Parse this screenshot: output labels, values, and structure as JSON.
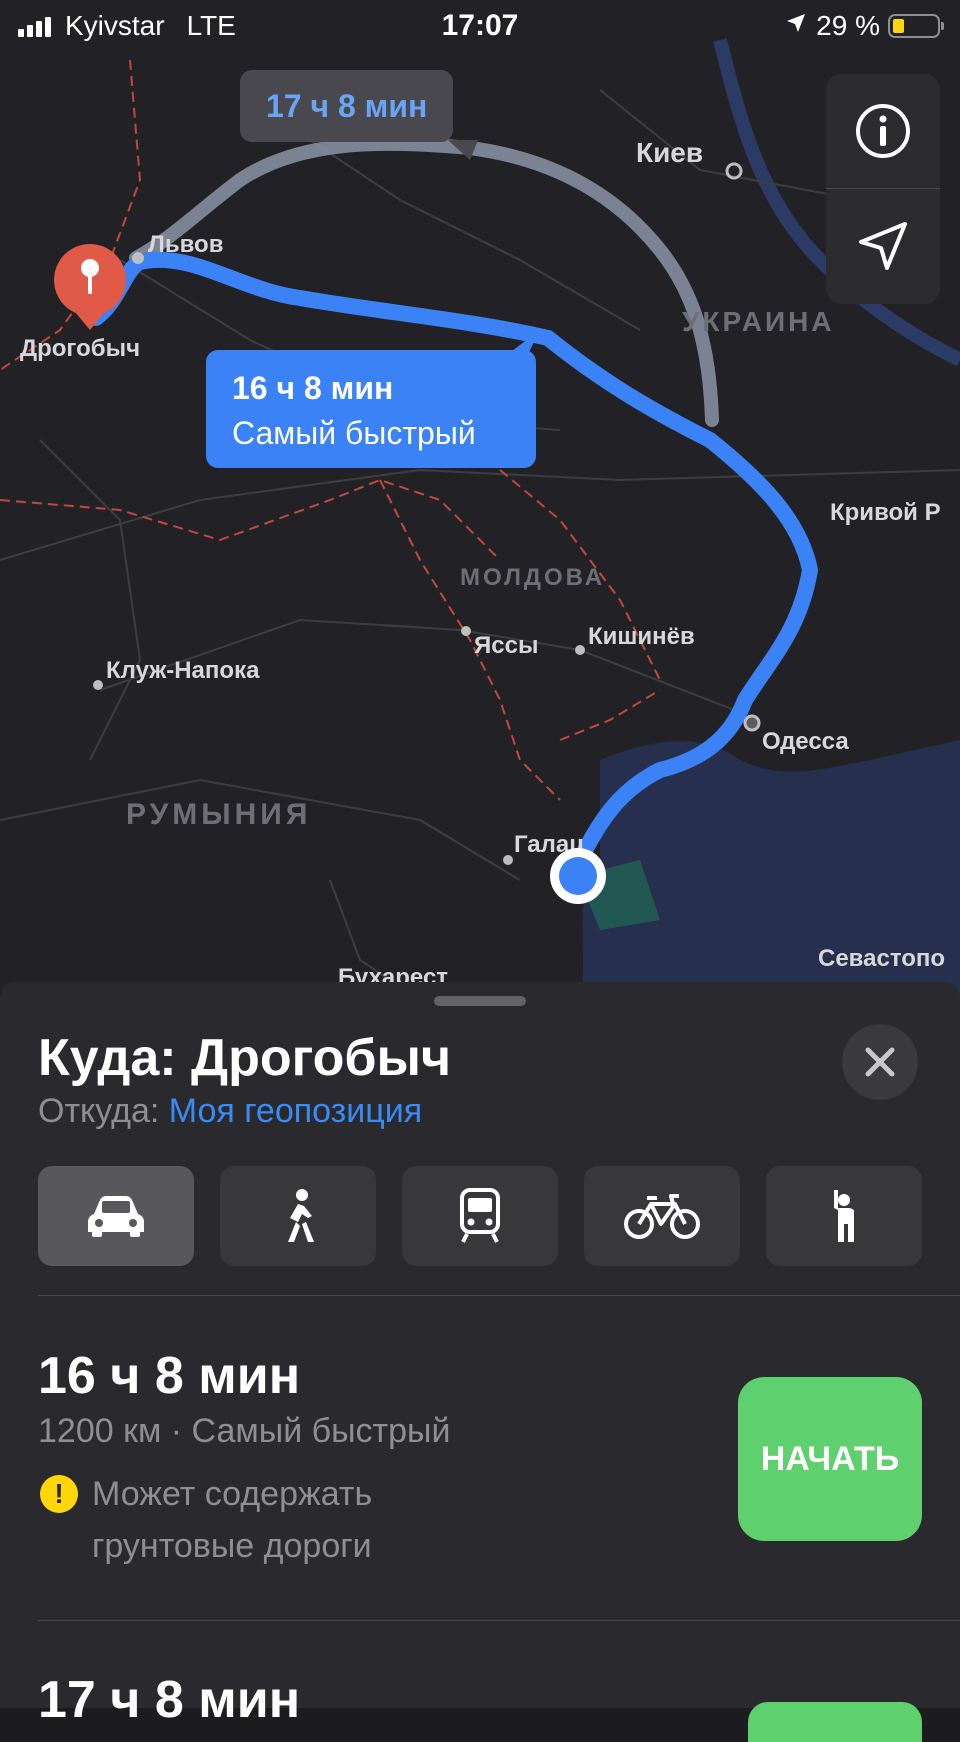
{
  "status_bar": {
    "carrier": "Kyivstar",
    "network": "LTE",
    "time": "17:07",
    "battery": "29 %"
  },
  "map": {
    "labels": {
      "kiev": "Киев",
      "lviv": "Львов",
      "drohobych": "Дрогобыч",
      "ukraine": "УКРАИНА",
      "kryvyi_rih": "Кривой Р",
      "moldova": "МОЛДОВА",
      "iasi": "Яссы",
      "chisinau": "Кишинёв",
      "cluj": "Клуж-Напока",
      "odesa": "Одесса",
      "romania": "РУМЫНИЯ",
      "galati": "Галац",
      "bucharest": "Бухарест",
      "sevastopol": "Севастопо"
    },
    "alt_route_bubble": "17 ч 8 мин",
    "fast_route_bubble": {
      "time": "16 ч 8 мин",
      "label": "Самый быстрый"
    }
  },
  "sheet": {
    "destination": "Куда: Дрогобыч",
    "from_label": "Откуда:",
    "from_value": "Моя геопозиция",
    "modes": [
      "car-icon",
      "walk-icon",
      "transit-icon",
      "bike-icon",
      "rideshare-icon"
    ],
    "routes": [
      {
        "time": "16 ч 8 мин",
        "details": "1200 км · Самый быстрый",
        "warning_line1": "Может содержать",
        "warning_line2": "грунтовые дороги",
        "warning_badge": "!",
        "go_label": "НАЧАТЬ"
      },
      {
        "time": "17 ч 8 мин"
      }
    ]
  },
  "colors": {
    "route_primary": "#3b82f6",
    "route_alt": "#8a93a8",
    "go": "#5fd06e",
    "accent": "#3a8bf5"
  }
}
